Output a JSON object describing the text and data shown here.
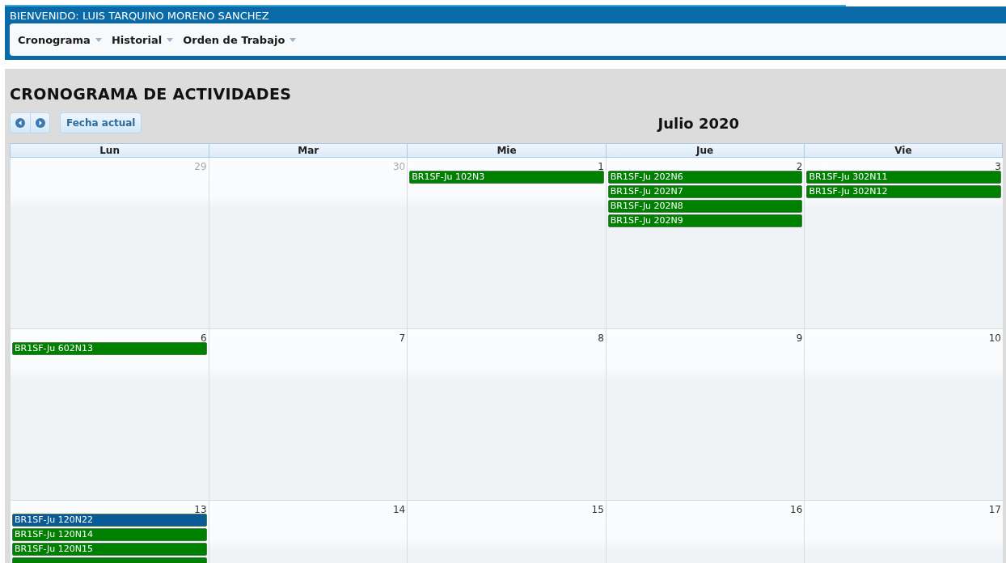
{
  "header": {
    "welcome": "BIENVENIDO: LUIS TARQUINO MORENO SANCHEZ"
  },
  "menu": [
    {
      "label": "Cronograma"
    },
    {
      "label": "Historial"
    },
    {
      "label": "Orden de Trabajo"
    }
  ],
  "page_title": "CRONOGRAMA DE ACTIVIDADES",
  "toolbar": {
    "today_button": "Fecha actual",
    "month_title": "Julio 2020"
  },
  "weekdays": [
    "Lun",
    "Mar",
    "Mie",
    "Jue",
    "Vie"
  ],
  "weeks": [
    {
      "days": [
        {
          "day": "29",
          "other_month": true
        },
        {
          "day": "30",
          "other_month": true
        },
        {
          "day": "1",
          "other_month": false,
          "events": [
            {
              "label": "BR1SF-Ju 102N3",
              "color": "#008000"
            }
          ]
        },
        {
          "day": "2",
          "other_month": false,
          "events": [
            {
              "label": "BR1SF-Ju 202N6",
              "color": "#008000"
            },
            {
              "label": "BR1SF-Ju 202N7",
              "color": "#008000"
            },
            {
              "label": "BR1SF-Ju 202N8",
              "color": "#008000"
            },
            {
              "label": "BR1SF-Ju 202N9",
              "color": "#008000"
            }
          ]
        },
        {
          "day": "3",
          "other_month": false,
          "events": [
            {
              "label": "BR1SF-Ju 302N11",
              "color": "#008000"
            },
            {
              "label": "BR1SF-Ju 302N12",
              "color": "#008000"
            }
          ]
        }
      ]
    },
    {
      "days": [
        {
          "day": "6",
          "other_month": false,
          "events": [
            {
              "label": "BR1SF-Ju 602N13",
              "color": "#008000"
            }
          ]
        },
        {
          "day": "7",
          "other_month": false
        },
        {
          "day": "8",
          "other_month": false
        },
        {
          "day": "9",
          "other_month": false
        },
        {
          "day": "10",
          "other_month": false
        }
      ]
    },
    {
      "days": [
        {
          "day": "13",
          "other_month": false,
          "events": [
            {
              "label": "BR1SF-Ju 120N22",
              "color": "#0a5a96"
            },
            {
              "label": "BR1SF-Ju 120N14",
              "color": "#008000"
            },
            {
              "label": "BR1SF-Ju 120N15",
              "color": "#008000"
            },
            {
              "color": "#008000"
            }
          ]
        },
        {
          "day": "14",
          "other_month": false
        },
        {
          "day": "15",
          "other_month": false
        },
        {
          "day": "16",
          "other_month": false
        },
        {
          "day": "17",
          "other_month": false
        }
      ]
    }
  ]
}
